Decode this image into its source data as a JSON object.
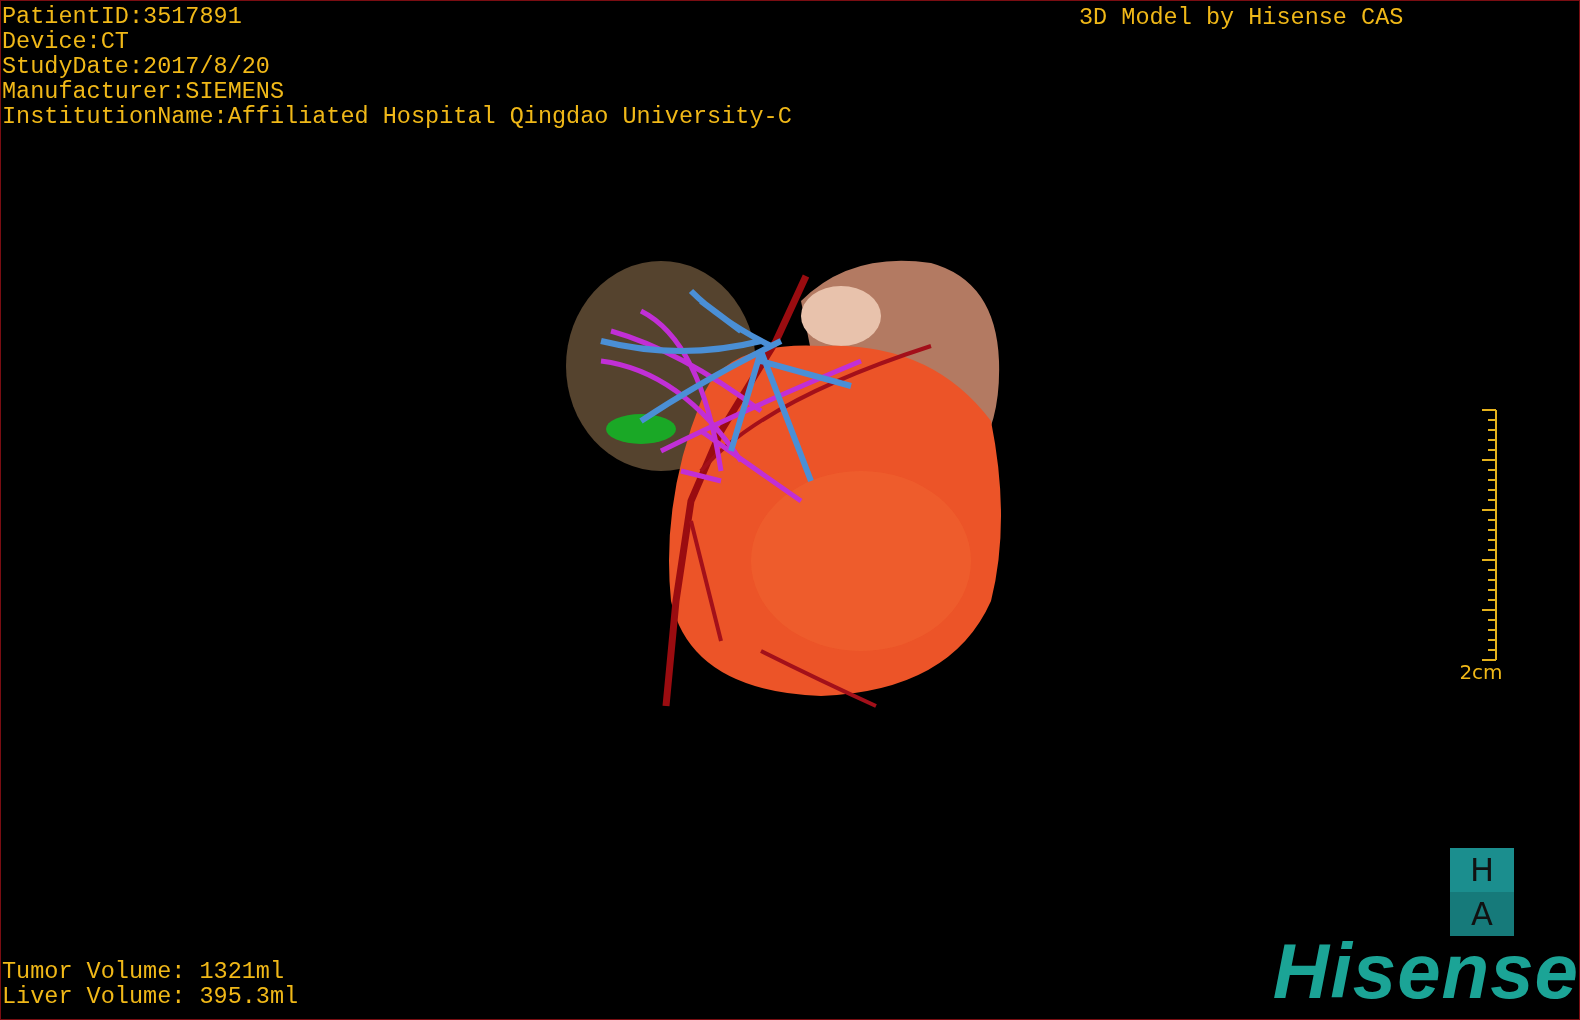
{
  "info_lines": [
    "PatientID:3517891",
    "Device:CT",
    "StudyDate:2017/8/20",
    "Manufacturer:SIEMENS",
    "InstitutionName:Affiliated Hospital Qingdao University-C"
  ],
  "title": "3D Model by Hisense CAS",
  "volumes": [
    "Tumor Volume: 1321ml",
    "Liver Volume: 395.3ml"
  ],
  "scale_bar": {
    "label": "2cm"
  },
  "orientation_cube": {
    "top": "H",
    "bottom": "A"
  },
  "logo": "Hisense"
}
